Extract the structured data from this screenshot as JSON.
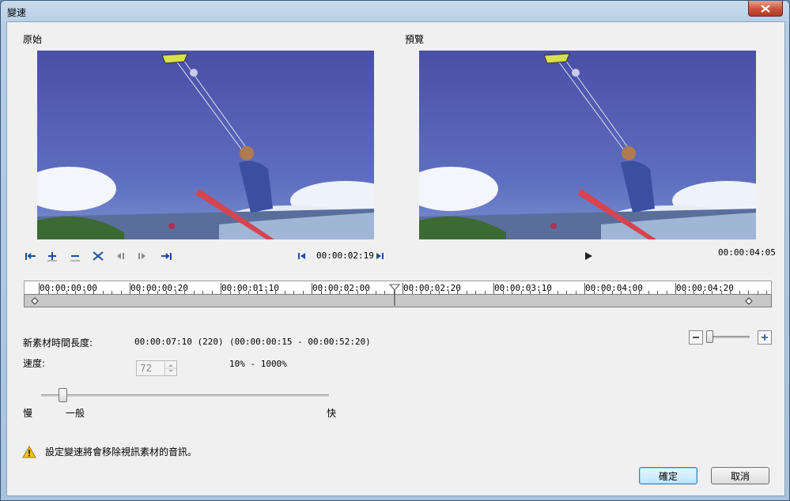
{
  "window": {
    "title": "變速"
  },
  "original": {
    "label": "原始",
    "timecode": "00:00:02:19"
  },
  "preview": {
    "label": "預覽",
    "duration": "00:00:04:05"
  },
  "timeline": {
    "ticks": [
      "00:00:00:00",
      "00:00:00:20",
      "00:00:01:10",
      "00:00:02:00",
      "00:00:02:20",
      "00:00:03:10",
      "00:00:04:00",
      "00:00:04:20"
    ],
    "playhead_position": 0.497
  },
  "new_duration": {
    "label": "新素材時間長度:",
    "value": "00:00:07:10 (220)",
    "range": "(00:00:00:15 - 00:00:52:20)"
  },
  "speed": {
    "label": "速度:",
    "value": "72",
    "range": "10% - 1000%",
    "slow": "慢",
    "normal": "一般",
    "fast": "快",
    "slider_fraction": 0.075
  },
  "zoom": {
    "slider_fraction": 0.05
  },
  "warning": {
    "text": "設定變速將會移除視訊素材的音訊。",
    "icon": "warning-icon"
  },
  "buttons": {
    "ok": "確定",
    "cancel": "取消"
  }
}
